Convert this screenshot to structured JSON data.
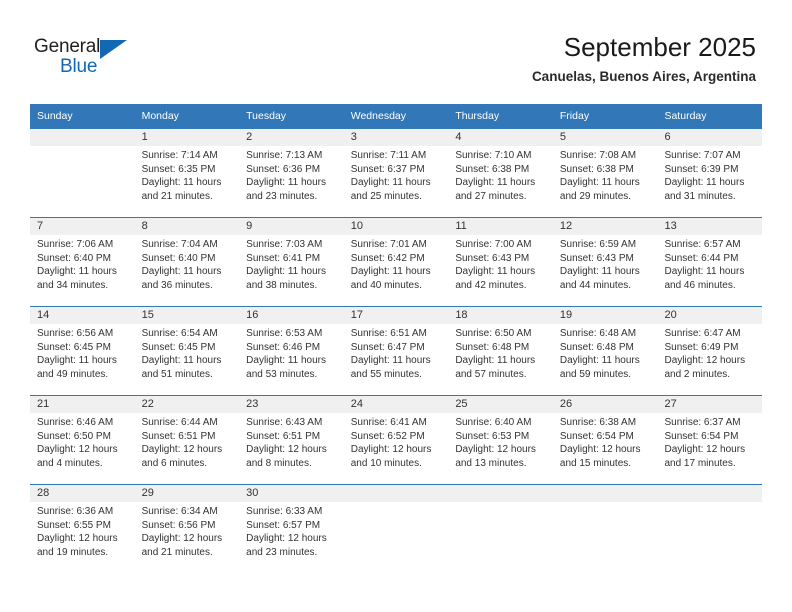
{
  "brand": {
    "name_top": "General",
    "name_bottom": "Blue",
    "accent_color": "#1268b3",
    "triangle_icon": "triangle-icon"
  },
  "header": {
    "title": "September 2025",
    "subtitle": "Canuelas, Buenos Aires, Argentina"
  },
  "calendar": {
    "header_bg": "#3277b8",
    "header_text_color": "#ffffff",
    "day_band_bg": "#f0f0f0",
    "weekdays": [
      "Sunday",
      "Monday",
      "Tuesday",
      "Wednesday",
      "Thursday",
      "Friday",
      "Saturday"
    ],
    "weeks": [
      [
        {
          "day": "",
          "sunrise": "",
          "sunset": "",
          "daylight": "",
          "empty": true
        },
        {
          "day": "1",
          "sunrise": "Sunrise: 7:14 AM",
          "sunset": "Sunset: 6:35 PM",
          "daylight": "Daylight: 11 hours and 21 minutes."
        },
        {
          "day": "2",
          "sunrise": "Sunrise: 7:13 AM",
          "sunset": "Sunset: 6:36 PM",
          "daylight": "Daylight: 11 hours and 23 minutes."
        },
        {
          "day": "3",
          "sunrise": "Sunrise: 7:11 AM",
          "sunset": "Sunset: 6:37 PM",
          "daylight": "Daylight: 11 hours and 25 minutes."
        },
        {
          "day": "4",
          "sunrise": "Sunrise: 7:10 AM",
          "sunset": "Sunset: 6:38 PM",
          "daylight": "Daylight: 11 hours and 27 minutes."
        },
        {
          "day": "5",
          "sunrise": "Sunrise: 7:08 AM",
          "sunset": "Sunset: 6:38 PM",
          "daylight": "Daylight: 11 hours and 29 minutes."
        },
        {
          "day": "6",
          "sunrise": "Sunrise: 7:07 AM",
          "sunset": "Sunset: 6:39 PM",
          "daylight": "Daylight: 11 hours and 31 minutes."
        }
      ],
      [
        {
          "day": "7",
          "sunrise": "Sunrise: 7:06 AM",
          "sunset": "Sunset: 6:40 PM",
          "daylight": "Daylight: 11 hours and 34 minutes."
        },
        {
          "day": "8",
          "sunrise": "Sunrise: 7:04 AM",
          "sunset": "Sunset: 6:40 PM",
          "daylight": "Daylight: 11 hours and 36 minutes."
        },
        {
          "day": "9",
          "sunrise": "Sunrise: 7:03 AM",
          "sunset": "Sunset: 6:41 PM",
          "daylight": "Daylight: 11 hours and 38 minutes."
        },
        {
          "day": "10",
          "sunrise": "Sunrise: 7:01 AM",
          "sunset": "Sunset: 6:42 PM",
          "daylight": "Daylight: 11 hours and 40 minutes."
        },
        {
          "day": "11",
          "sunrise": "Sunrise: 7:00 AM",
          "sunset": "Sunset: 6:43 PM",
          "daylight": "Daylight: 11 hours and 42 minutes."
        },
        {
          "day": "12",
          "sunrise": "Sunrise: 6:59 AM",
          "sunset": "Sunset: 6:43 PM",
          "daylight": "Daylight: 11 hours and 44 minutes."
        },
        {
          "day": "13",
          "sunrise": "Sunrise: 6:57 AM",
          "sunset": "Sunset: 6:44 PM",
          "daylight": "Daylight: 11 hours and 46 minutes."
        }
      ],
      [
        {
          "day": "14",
          "sunrise": "Sunrise: 6:56 AM",
          "sunset": "Sunset: 6:45 PM",
          "daylight": "Daylight: 11 hours and 49 minutes."
        },
        {
          "day": "15",
          "sunrise": "Sunrise: 6:54 AM",
          "sunset": "Sunset: 6:45 PM",
          "daylight": "Daylight: 11 hours and 51 minutes."
        },
        {
          "day": "16",
          "sunrise": "Sunrise: 6:53 AM",
          "sunset": "Sunset: 6:46 PM",
          "daylight": "Daylight: 11 hours and 53 minutes."
        },
        {
          "day": "17",
          "sunrise": "Sunrise: 6:51 AM",
          "sunset": "Sunset: 6:47 PM",
          "daylight": "Daylight: 11 hours and 55 minutes."
        },
        {
          "day": "18",
          "sunrise": "Sunrise: 6:50 AM",
          "sunset": "Sunset: 6:48 PM",
          "daylight": "Daylight: 11 hours and 57 minutes."
        },
        {
          "day": "19",
          "sunrise": "Sunrise: 6:48 AM",
          "sunset": "Sunset: 6:48 PM",
          "daylight": "Daylight: 11 hours and 59 minutes."
        },
        {
          "day": "20",
          "sunrise": "Sunrise: 6:47 AM",
          "sunset": "Sunset: 6:49 PM",
          "daylight": "Daylight: 12 hours and 2 minutes."
        }
      ],
      [
        {
          "day": "21",
          "sunrise": "Sunrise: 6:46 AM",
          "sunset": "Sunset: 6:50 PM",
          "daylight": "Daylight: 12 hours and 4 minutes."
        },
        {
          "day": "22",
          "sunrise": "Sunrise: 6:44 AM",
          "sunset": "Sunset: 6:51 PM",
          "daylight": "Daylight: 12 hours and 6 minutes."
        },
        {
          "day": "23",
          "sunrise": "Sunrise: 6:43 AM",
          "sunset": "Sunset: 6:51 PM",
          "daylight": "Daylight: 12 hours and 8 minutes."
        },
        {
          "day": "24",
          "sunrise": "Sunrise: 6:41 AM",
          "sunset": "Sunset: 6:52 PM",
          "daylight": "Daylight: 12 hours and 10 minutes."
        },
        {
          "day": "25",
          "sunrise": "Sunrise: 6:40 AM",
          "sunset": "Sunset: 6:53 PM",
          "daylight": "Daylight: 12 hours and 13 minutes."
        },
        {
          "day": "26",
          "sunrise": "Sunrise: 6:38 AM",
          "sunset": "Sunset: 6:54 PM",
          "daylight": "Daylight: 12 hours and 15 minutes."
        },
        {
          "day": "27",
          "sunrise": "Sunrise: 6:37 AM",
          "sunset": "Sunset: 6:54 PM",
          "daylight": "Daylight: 12 hours and 17 minutes."
        }
      ],
      [
        {
          "day": "28",
          "sunrise": "Sunrise: 6:36 AM",
          "sunset": "Sunset: 6:55 PM",
          "daylight": "Daylight: 12 hours and 19 minutes."
        },
        {
          "day": "29",
          "sunrise": "Sunrise: 6:34 AM",
          "sunset": "Sunset: 6:56 PM",
          "daylight": "Daylight: 12 hours and 21 minutes."
        },
        {
          "day": "30",
          "sunrise": "Sunrise: 6:33 AM",
          "sunset": "Sunset: 6:57 PM",
          "daylight": "Daylight: 12 hours and 23 minutes."
        },
        {
          "day": "",
          "sunrise": "",
          "sunset": "",
          "daylight": "",
          "empty": true
        },
        {
          "day": "",
          "sunrise": "",
          "sunset": "",
          "daylight": "",
          "empty": true
        },
        {
          "day": "",
          "sunrise": "",
          "sunset": "",
          "daylight": "",
          "empty": true
        },
        {
          "day": "",
          "sunrise": "",
          "sunset": "",
          "daylight": "",
          "empty": true
        }
      ]
    ]
  }
}
